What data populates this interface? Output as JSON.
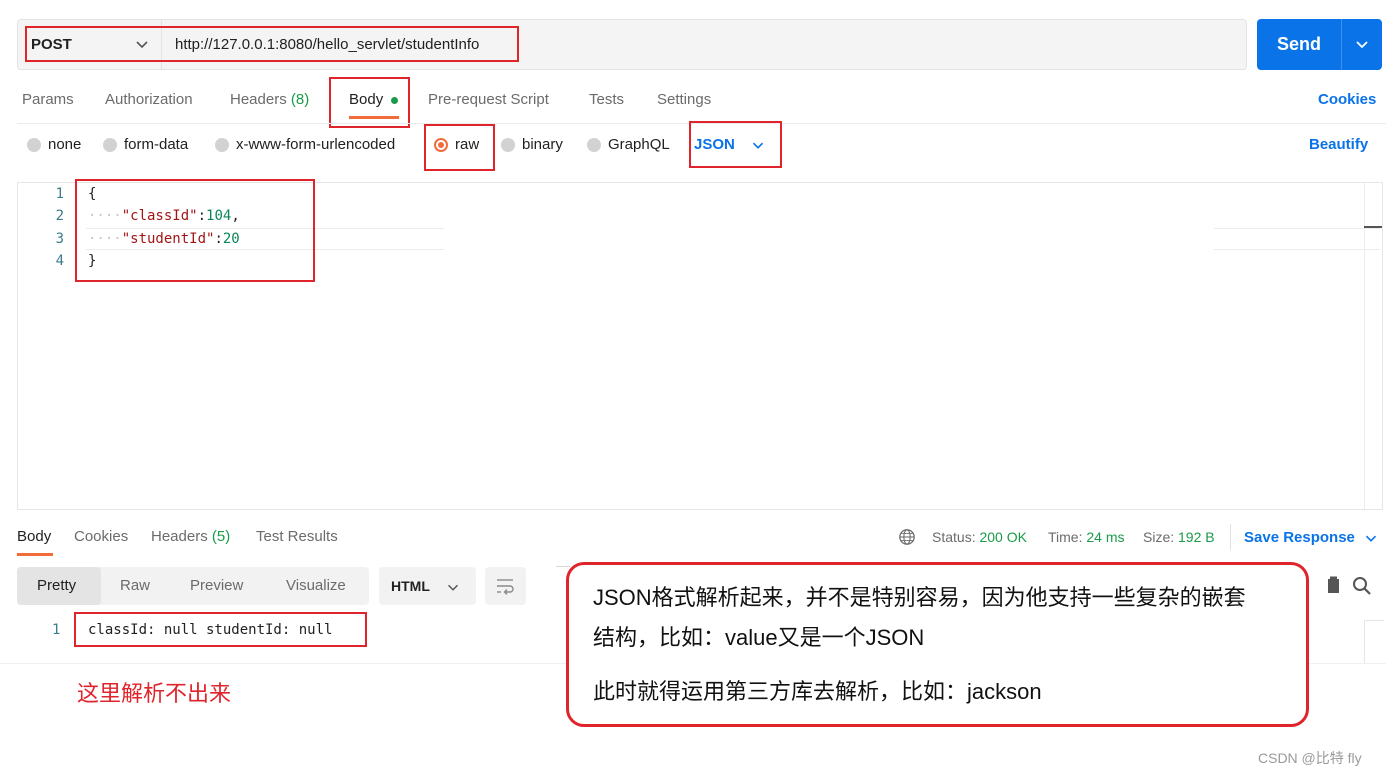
{
  "request": {
    "method": "POST",
    "url": "http://127.0.0.1:8080/hello_servlet/studentInfo",
    "send_label": "Send"
  },
  "tabs": {
    "params": "Params",
    "authorization": "Authorization",
    "headers_label": "Headers",
    "headers_count": "(8)",
    "body": "Body",
    "prerequest": "Pre-request Script",
    "tests": "Tests",
    "settings": "Settings",
    "cookies": "Cookies"
  },
  "body_types": {
    "none": "none",
    "form_data": "form-data",
    "urlencoded": "x-www-form-urlencoded",
    "raw": "raw",
    "binary": "binary",
    "graphql": "GraphQL",
    "selected": "raw",
    "language": "JSON",
    "beautify": "Beautify"
  },
  "editor": {
    "line_numbers": [
      "1",
      "2",
      "3",
      "4"
    ],
    "open_brace": "{",
    "indent": "····",
    "key1": "\"classId\"",
    "val1": "104",
    "key2": "\"studentId\"",
    "val2": "20",
    "close_brace": "}"
  },
  "response": {
    "tabs": {
      "body": "Body",
      "cookies": "Cookies",
      "headers_label": "Headers",
      "headers_count": "(5)",
      "test_results": "Test Results"
    },
    "status_label": "Status:",
    "status_value": "200 OK",
    "time_label": "Time:",
    "time_value": "24 ms",
    "size_label": "Size:",
    "size_value": "192 B",
    "save_response": "Save Response",
    "views": [
      "Pretty",
      "Raw",
      "Preview",
      "Visualize"
    ],
    "format": "HTML",
    "line_number": "1",
    "line_text": "classId: null studentId: null"
  },
  "annotations": {
    "left_note": "这里解析不出来",
    "box_line1": "JSON格式解析起来，并不是特别容易，因为他支持一些复杂的嵌套",
    "box_line2": "结构，比如：value又是一个JSON",
    "box_line3": "此时就得运用第三方库去解析，比如：jackson"
  },
  "watermark": "CSDN @比特 fly",
  "colors": {
    "accent_blue": "#0b73e8",
    "accent_orange": "#f26b3a",
    "success_green": "#1a9b4a",
    "annotation_red": "#e0242b"
  },
  "icons": [
    "chevron-down-icon",
    "globe-icon",
    "wrap-icon",
    "copy-icon",
    "search-icon"
  ]
}
